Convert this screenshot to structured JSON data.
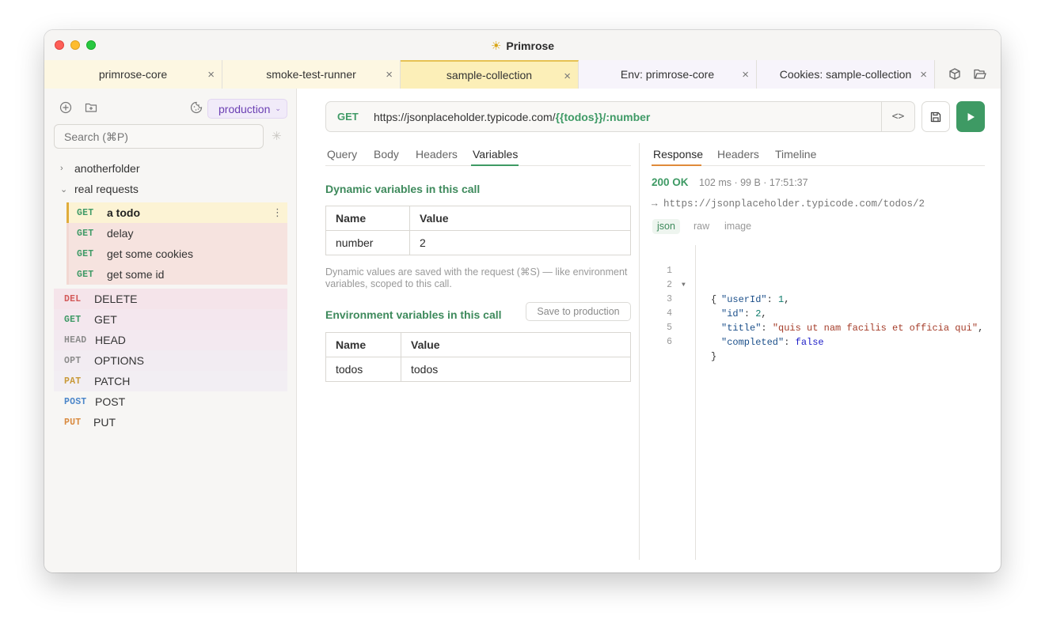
{
  "app": {
    "title": "Primrose"
  },
  "tabs": [
    {
      "label": "primrose-core"
    },
    {
      "label": "smoke-test-runner"
    },
    {
      "label": "sample-collection"
    },
    {
      "label": "Env: primrose-core"
    },
    {
      "label": "Cookies: sample-collection"
    }
  ],
  "sidebar": {
    "environment": "production",
    "search_placeholder": "Search (⌘P)",
    "folders": [
      {
        "name": "anotherfolder"
      },
      {
        "name": "real requests"
      }
    ],
    "folder_requests": [
      {
        "method": "GET",
        "name": "a todo"
      },
      {
        "method": "GET",
        "name": "delay"
      },
      {
        "method": "GET",
        "name": "get some cookies"
      },
      {
        "method": "GET",
        "name": "get some id"
      }
    ],
    "requests": [
      {
        "method": "DEL",
        "name": "DELETE"
      },
      {
        "method": "GET",
        "name": "GET"
      },
      {
        "method": "HEAD",
        "name": "HEAD"
      },
      {
        "method": "OPT",
        "name": "OPTIONS"
      },
      {
        "method": "PAT",
        "name": "PATCH"
      },
      {
        "method": "POST",
        "name": "POST"
      },
      {
        "method": "PUT",
        "name": "PUT"
      }
    ]
  },
  "request": {
    "method": "GET",
    "url_base": "https://jsonplaceholder.typicode.com/",
    "url_var": "{{todos}}",
    "url_path": "/:number",
    "tabs": [
      "Query",
      "Body",
      "Headers",
      "Variables"
    ],
    "dynamic_title": "Dynamic variables in this call",
    "table_headers": [
      "Name",
      "Value"
    ],
    "dynamic_rows": [
      {
        "name": "number",
        "value": "2"
      }
    ],
    "hint": "Dynamic values are saved with the request (⌘S) — like environment variables, scoped to this call.",
    "env_title": "Environment variables in this call",
    "save_button": "Save to production",
    "env_rows": [
      {
        "name": "todos",
        "value": "todos"
      }
    ]
  },
  "response": {
    "tabs": [
      "Response",
      "Headers",
      "Timeline"
    ],
    "status": "200 OK",
    "meta": "102 ms · 99 B · 17:51:37",
    "url": "→ https://jsonplaceholder.typicode.com/todos/2",
    "formats": [
      "json",
      "raw",
      "image"
    ],
    "line_numbers": [
      "1",
      "2",
      "3",
      "4",
      "5",
      "6"
    ],
    "body": {
      "open": "{",
      "userId_key": "\"userId\"",
      "userId_val": "1",
      "id_key": "\"id\"",
      "id_val": "2",
      "title_key": "\"title\"",
      "title_val": "\"quis ut nam facilis et officia qui\"",
      "completed_key": "\"completed\"",
      "completed_val": "false",
      "close": "}"
    }
  },
  "colors": {
    "accent": "#3e9a64",
    "active_tab": "#fcefb8",
    "env": "#6b3fb3",
    "response_tab": "#e08a3a"
  }
}
